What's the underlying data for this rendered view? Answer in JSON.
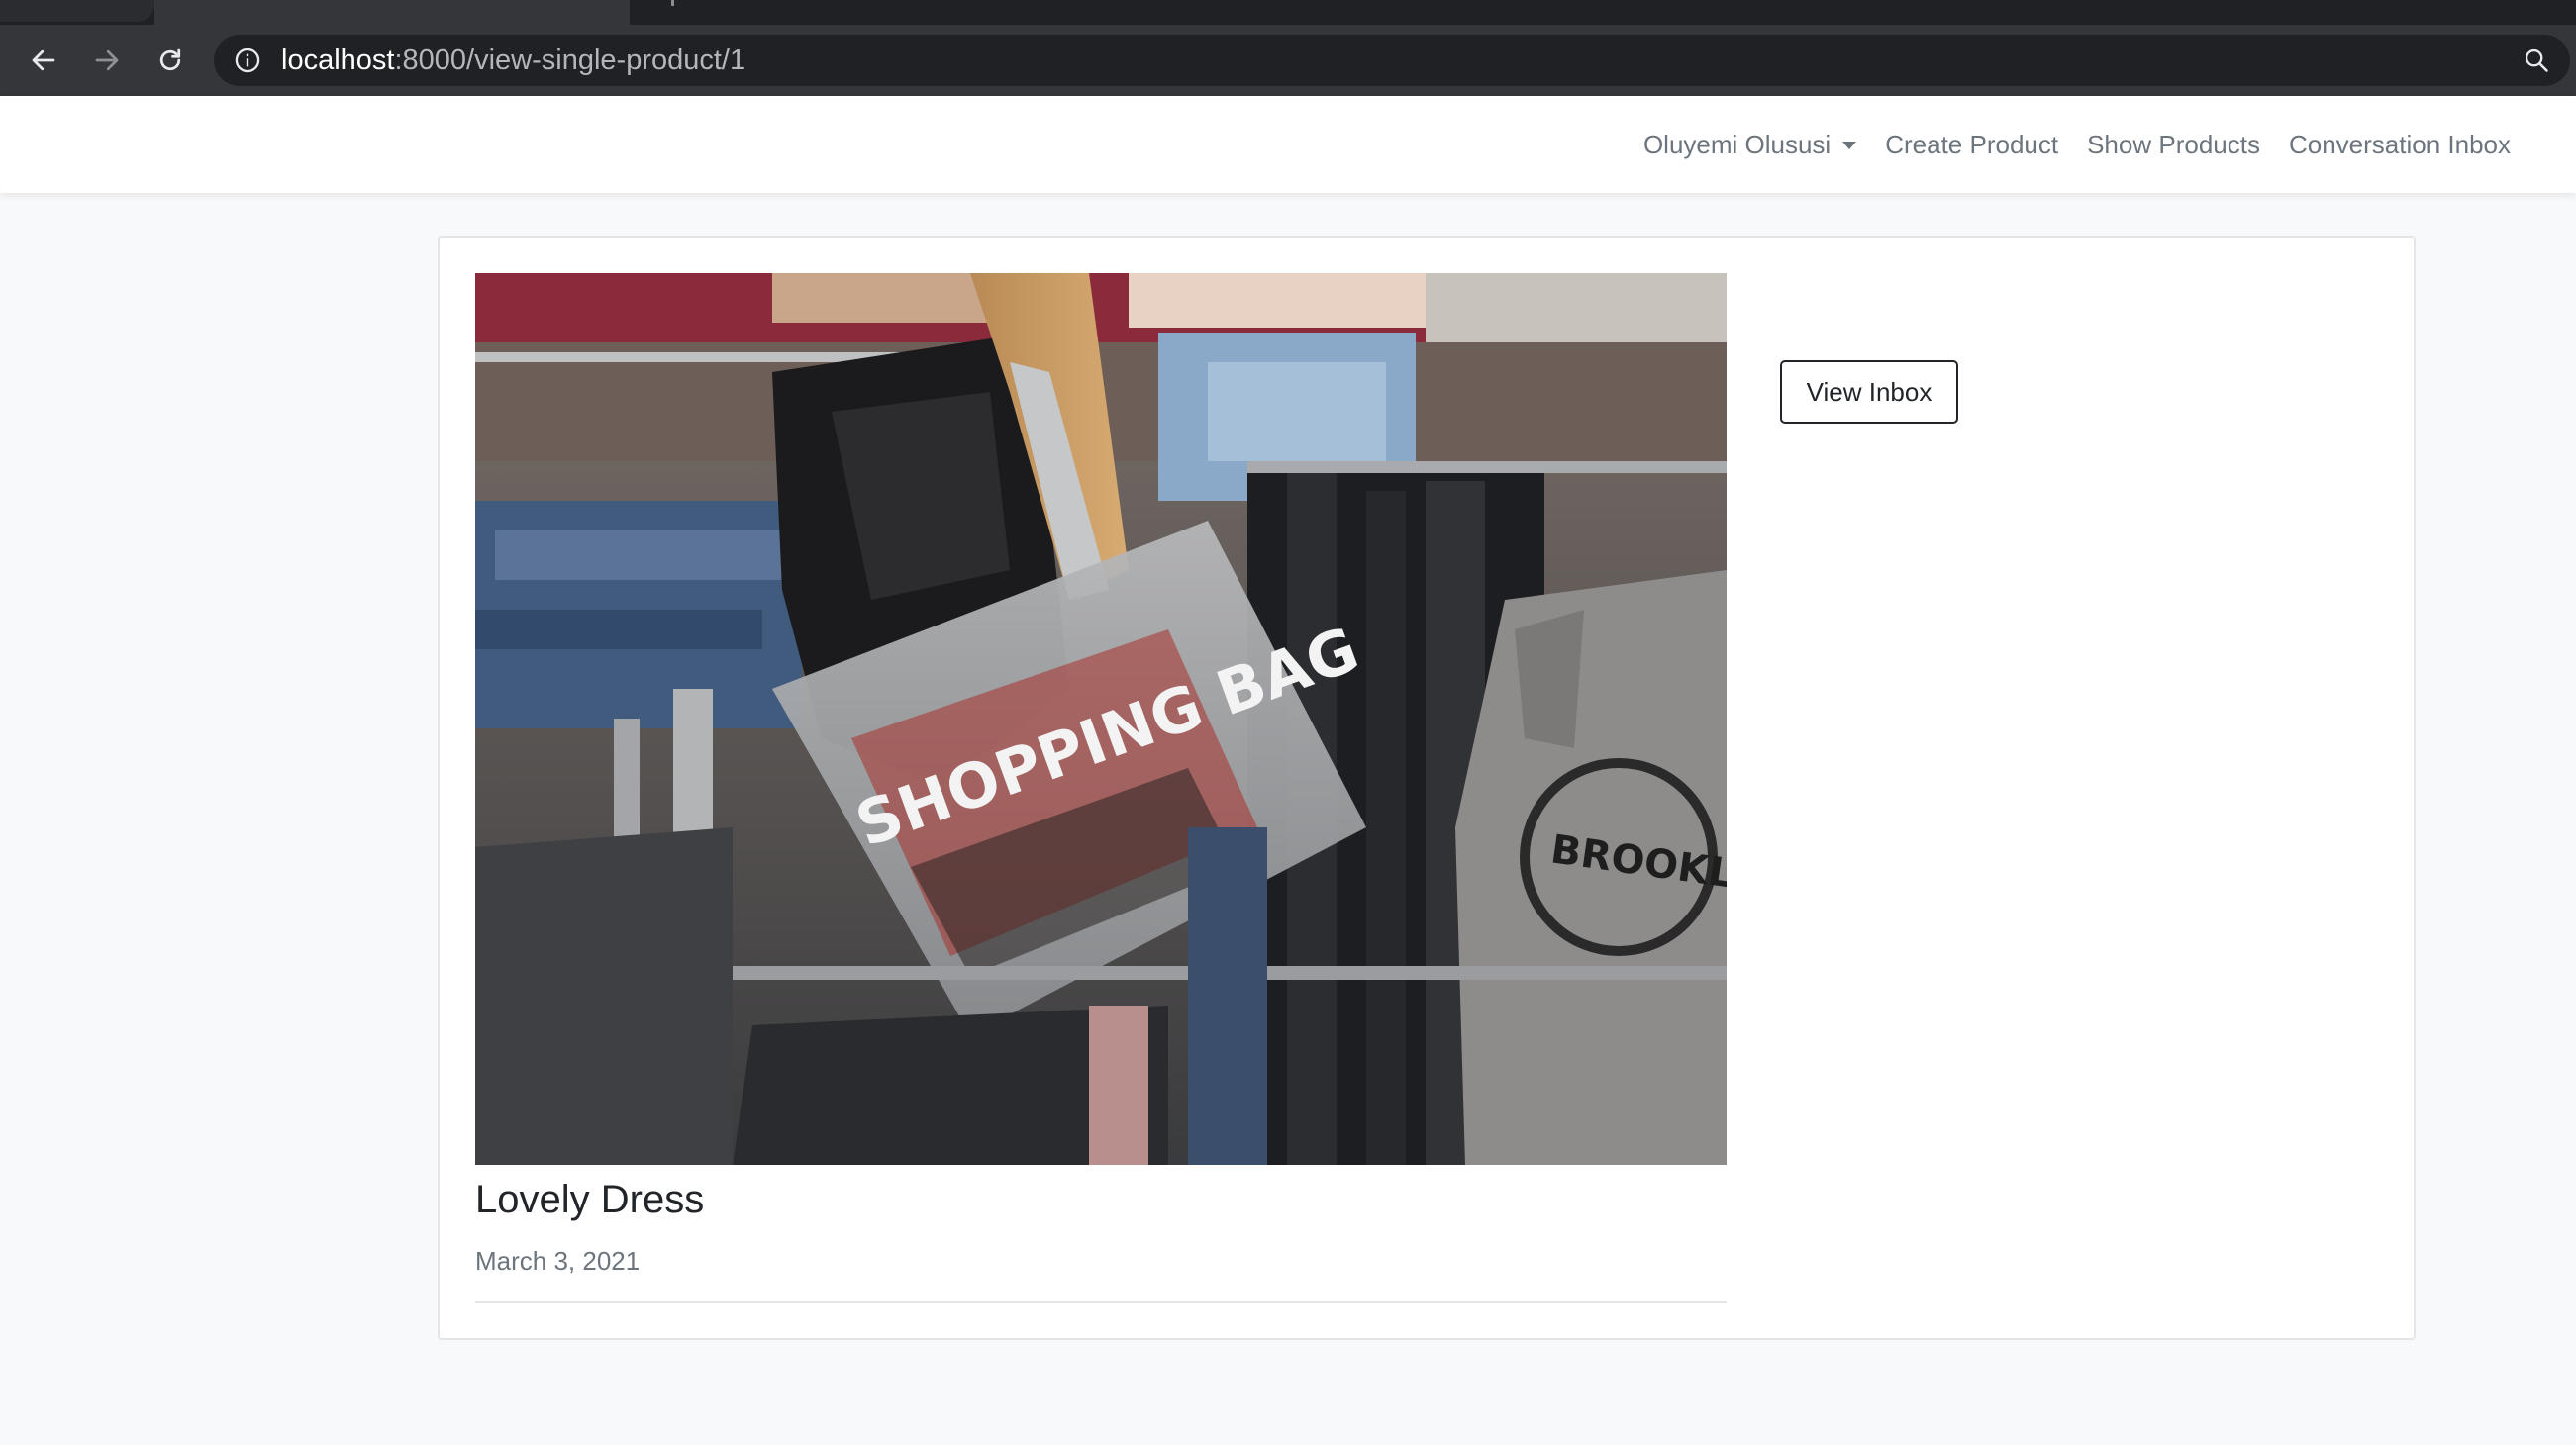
{
  "browser": {
    "url_host": "localhost",
    "url_path": ":8000/view-single-product/1",
    "back_icon": "arrow-left-icon",
    "forward_icon": "arrow-right-icon",
    "reload_icon": "reload-icon",
    "info_icon": "info-circle-icon",
    "zoom_icon": "magnifier-icon"
  },
  "navbar": {
    "user_name": "Oluyemi Olususi",
    "links": [
      "Create Product",
      "Show Products",
      "Conversation Inbox"
    ]
  },
  "product": {
    "image_caption": "SHOPPING BAG",
    "title": "Lovely Dress",
    "date": "March 3, 2021"
  },
  "actions": {
    "view_inbox_label": "View Inbox"
  },
  "colors": {
    "chrome_bg": "#35363a",
    "omnibox_bg": "#202124",
    "page_bg": "#f8f9fa",
    "nav_text": "#6c757d"
  }
}
